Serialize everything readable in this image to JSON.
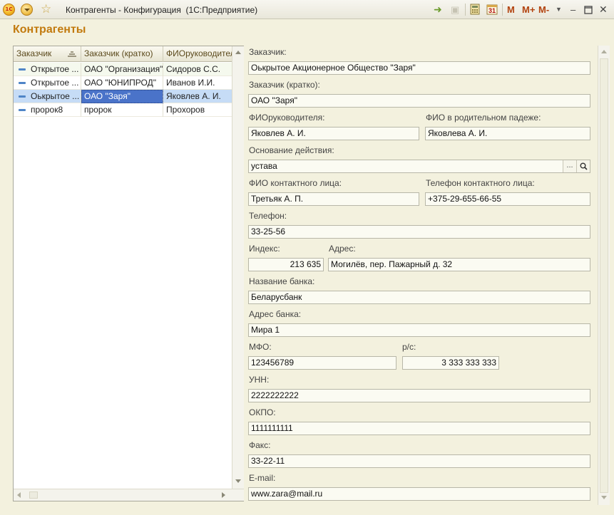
{
  "window": {
    "title": "Контрагенты - Конфигурация  (1С:Предприятие)",
    "logo_text": "1С",
    "toolbar_right": {
      "m_label": "M",
      "m_plus_label": "M+",
      "m_minus_label": "M-",
      "calendar_day": "31"
    }
  },
  "form": {
    "title": "Контрагенты"
  },
  "table": {
    "columns": [
      "Заказчик",
      "Заказчик (кратко)",
      "ФИОруководител"
    ],
    "rows": [
      {
        "c1": "Открытое ...",
        "c2": "ОАО \"Организация\"",
        "c3": "Сидоров С.С."
      },
      {
        "c1": "Открытое ...",
        "c2": "ОАО \"ЮНИПРОД\"",
        "c3": "Иванов И.И."
      },
      {
        "c1": "Оькрытое ...",
        "c2": "ОАО \"Заря\"",
        "c3": "Яковлев А. И."
      },
      {
        "c1": "пророк8",
        "c2": "пророк",
        "c3": "Прохоров"
      }
    ],
    "selected_row": 3
  },
  "details": {
    "customer": {
      "label": "Заказчик:",
      "value": "Оькрытое Акционерное Общество \"Заря\""
    },
    "customer_short": {
      "label": "Заказчик (кратко):",
      "value": "ОАО \"Заря\""
    },
    "director": {
      "label": "ФИОруководителя:",
      "value": "Яковлев А. И."
    },
    "director_genitive": {
      "label": "ФИО в родительном падеже:",
      "value": "Яковлева А. И."
    },
    "basis": {
      "label": "Основание действия:",
      "value": "устава",
      "select_label": "...",
      "search_icon": "magnifier-icon"
    },
    "contact_name": {
      "label": "ФИО контактного лица:",
      "value": "Третьяк А. П."
    },
    "contact_phone": {
      "label": "Телефон контактного лица:",
      "value": "+375-29-655-66-55"
    },
    "phone": {
      "label": "Телефон:",
      "value": "33-25-56"
    },
    "index": {
      "label": "Индекс:",
      "value": "213 635"
    },
    "address": {
      "label": "Адрес:",
      "value": "Могилёв, пер. Пажарный д. 32"
    },
    "bank_name": {
      "label": "Название банка:",
      "value": "Беларусбанк"
    },
    "bank_address": {
      "label": "Адрес банка:",
      "value": "Мира 1"
    },
    "mfo": {
      "label": "МФО:",
      "value": "123456789"
    },
    "account": {
      "label": "р/с:",
      "value": "3 333 333 333"
    },
    "unn": {
      "label": "УНН:",
      "value": "2222222222"
    },
    "okpo": {
      "label": "ОКПО:",
      "value": "1111111111"
    },
    "fax": {
      "label": "Факс:",
      "value": "33-22-11"
    },
    "email": {
      "label": "E-mail:",
      "value": "www.zara@mail.ru"
    }
  },
  "colors": {
    "accent": "#c27a0e",
    "selection": "#4a73c9",
    "row_selected": "#c6dcf6"
  }
}
